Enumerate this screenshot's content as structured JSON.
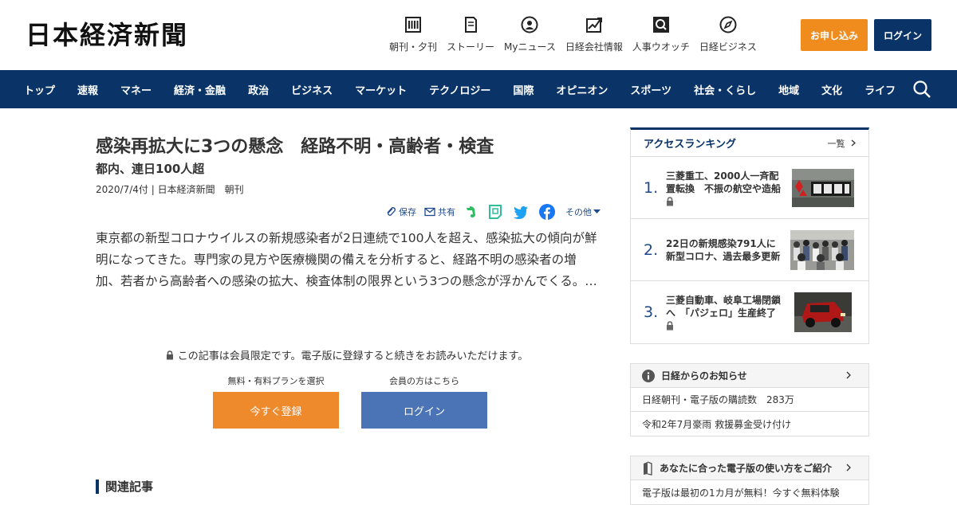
{
  "header": {
    "logo": "日本経済新聞",
    "nav": [
      {
        "label": "朝刊・夕刊",
        "icon": "newspaper-icon"
      },
      {
        "label": "ストーリー",
        "icon": "story-icon"
      },
      {
        "label": "Myニュース",
        "icon": "user-icon"
      },
      {
        "label": "日経会社情報",
        "icon": "chart-icon"
      },
      {
        "label": "人事ウオッチ",
        "icon": "search-person-icon"
      },
      {
        "label": "日経ビジネス",
        "icon": "compass-icon"
      }
    ],
    "apply_label": "お申し込み",
    "login_label": "ログイン"
  },
  "navbar": {
    "items": [
      "トップ",
      "速報",
      "マネー",
      "経済・金融",
      "政治",
      "ビジネス",
      "マーケット",
      "テクノロジー",
      "国際",
      "オピニオン",
      "スポーツ",
      "社会・くらし",
      "地域",
      "文化",
      "ライフ"
    ]
  },
  "article": {
    "title": "感染再拡大に3つの懸念　経路不明・高齢者・検査",
    "subtitle": "都内、連日100人超",
    "meta": "2020/7/4付 | 日本経済新聞　朝刊",
    "share": {
      "save": "保存",
      "share": "共有",
      "more": "その他"
    },
    "body": "東京都の新型コロナウイルスの新規感染者が2日連続で100人を超え、感染拡大の傾向が鮮明になってきた。専門家の見方や医療機関の備えを分析すると、経路不明の感染者の増加、若者から高齢者への感染の拡大、検査体制の限界という3つの懸念が浮かんでくる。…",
    "paywall": {
      "message": "この記事は会員限定です。電子版に登録すると続きをお読みいただけます。",
      "register_caption": "無料・有料プランを選択",
      "register_label": "今すぐ登録",
      "login_caption": "会員の方はこちら",
      "login_label": "ログイン"
    },
    "related_heading": "関連記事"
  },
  "sidebar": {
    "ranking": {
      "title": "アクセスランキング",
      "more": "一覧",
      "items": [
        {
          "num": "1.",
          "text": "三菱重工、2000人一斉配置転換　不振の航空や造船",
          "locked": true
        },
        {
          "num": "2.",
          "text": "22日の新規感染791人に　新型コロナ、過去最多更新",
          "locked": false
        },
        {
          "num": "3.",
          "text": "三菱自動車、岐阜工場閉鎖へ　「パジェロ」生産終了",
          "locked": true
        }
      ]
    },
    "info": {
      "title": "日経からのお知らせ",
      "rows": [
        "日経朝刊・電子版の購読数　283万",
        "令和2年7月豪雨 救援募金受け付け"
      ]
    },
    "guide": {
      "title": "あなたに合った電子版の使い方をご紹介",
      "rows": [
        "電子版は最初の1カ月が無料！今すぐ無料体験"
      ]
    }
  },
  "colors": {
    "navy": "#0a3467",
    "orange": "#f08c1e",
    "blue_button": "#4a74b5"
  }
}
